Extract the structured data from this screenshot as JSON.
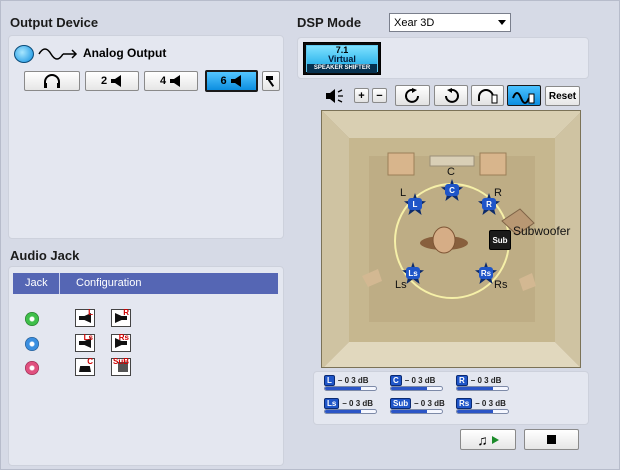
{
  "output_device": {
    "title": "Output Device",
    "analog_label": "Analog Output",
    "buttons": [
      {
        "label": "",
        "icon": "headphones-icon"
      },
      {
        "label": "2",
        "icon": "speaker-icon"
      },
      {
        "label": "4",
        "icon": "speaker-icon"
      },
      {
        "label": "6",
        "icon": "speaker-icon",
        "active": true
      }
    ]
  },
  "dsp": {
    "title": "DSP Mode",
    "mode_value": "Xear 3D",
    "badge_top": "7.1",
    "badge_mid": "Virtual",
    "badge_bot": "SPEAKER SHIFTER",
    "reset_label": "Reset"
  },
  "speakers": {
    "labels": {
      "C": "C",
      "L": "L",
      "R": "R",
      "Subwoofer": "Subwoofer",
      "Ls": "Ls",
      "Rs": "Rs"
    },
    "badges": {
      "C": "C",
      "L": "L",
      "R": "R",
      "Sub": "Sub",
      "Ls": "Ls",
      "Rs": "Rs"
    }
  },
  "levels": [
    {
      "tag": "L",
      "value": "– 0 3 dB",
      "fill": 0.7
    },
    {
      "tag": "C",
      "value": "– 0 3 dB",
      "fill": 0.7
    },
    {
      "tag": "R",
      "value": "– 0 3 dB",
      "fill": 0.7
    },
    {
      "tag": "Ls",
      "value": "– 0 3 dB",
      "fill": 0.7
    },
    {
      "tag": "Sub",
      "value": "– 0 3 dB",
      "fill": 0.7
    },
    {
      "tag": "Rs",
      "value": "– 0 3 dB",
      "fill": 0.7
    }
  ],
  "audio_jack": {
    "title": "Audio Jack",
    "col_jack": "Jack",
    "col_config": "Configuration",
    "jacks": [
      {
        "color": "#3fbf4a",
        "configs": [
          {
            "sub": "L"
          },
          {
            "sub": "R"
          }
        ]
      },
      {
        "color": "#3b8fe0",
        "configs": [
          {
            "sub": "Ls"
          },
          {
            "sub": "Rs"
          }
        ]
      },
      {
        "color": "#e0507f",
        "configs": [
          {
            "sub": "C"
          },
          {
            "sub": "SuB"
          }
        ]
      }
    ]
  },
  "colors": {
    "accent": "#0c8ee0",
    "header": "#5566b4",
    "badge": "#1f55c8"
  }
}
